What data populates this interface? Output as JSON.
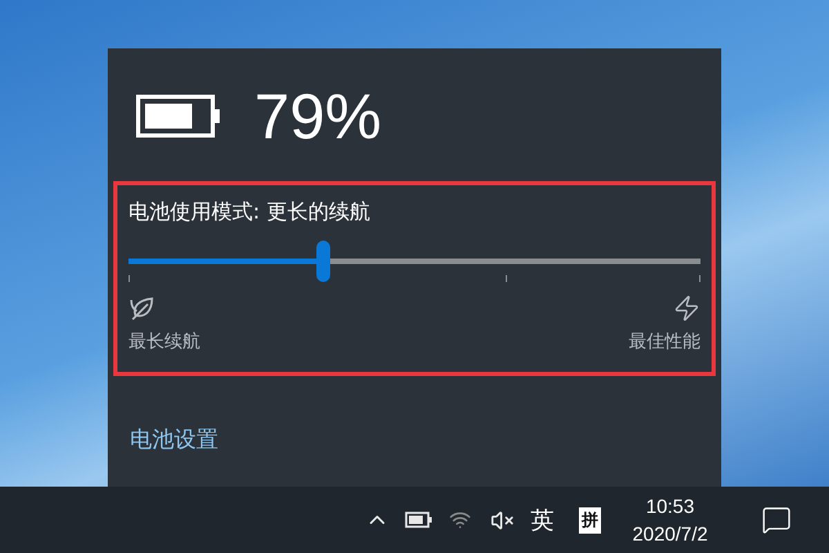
{
  "battery": {
    "percent": "79%"
  },
  "power_mode": {
    "title": "电池使用模式: 更长的续航",
    "level": 0.34,
    "min_label": "最长续航",
    "max_label": "最佳性能"
  },
  "settings_link": "电池设置",
  "taskbar": {
    "language": "英",
    "ime": "拼",
    "time": "10:53",
    "date": "2020/7/2"
  }
}
